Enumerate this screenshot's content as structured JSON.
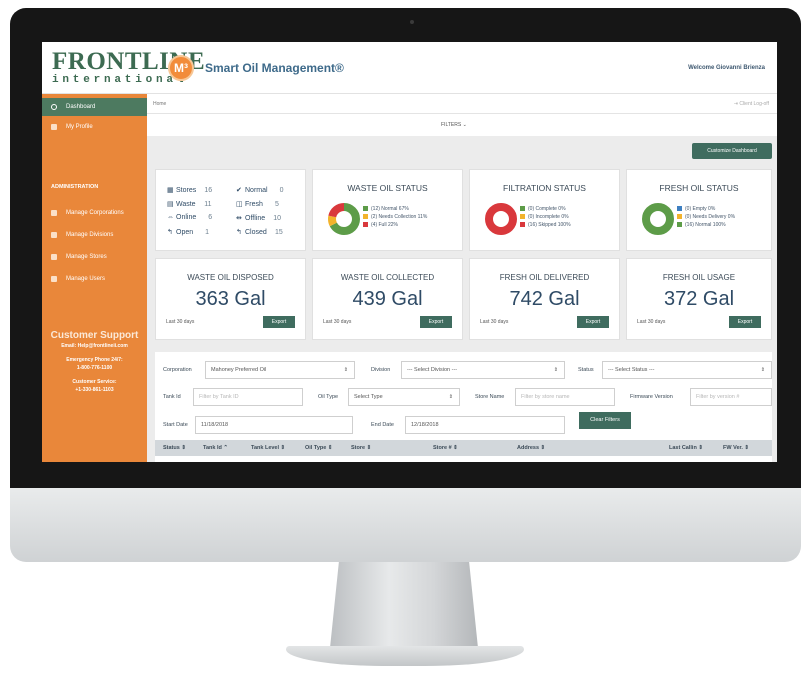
{
  "header": {
    "logo_main": "FRONTLINE",
    "logo_sub": "international",
    "app_badge": "M³",
    "app_title": "Smart Oil Management®",
    "welcome": "Welcome Giovanni Brienza"
  },
  "sidebar": {
    "items": [
      {
        "label": "Dashboard",
        "icon": "dashboard-icon"
      },
      {
        "label": "My Profile",
        "icon": "user-icon"
      }
    ],
    "admin_heading": "ADMINISTRATION",
    "admin_items": [
      {
        "label": "Manage Corporations",
        "icon": "building-icon"
      },
      {
        "label": "Manage Divisions",
        "icon": "folder-icon"
      },
      {
        "label": "Manage Stores",
        "icon": "chart-icon"
      },
      {
        "label": "Manage Users",
        "icon": "users-icon"
      }
    ],
    "support": {
      "title": "Customer Support",
      "email": "Email: Help@frontlineii.com",
      "emergency_label": "Emergency Phone 24/7:",
      "emergency_phone": "1-800-776-1100",
      "service_label": "Customer Service:",
      "service_phone": "+1-330-861-1103"
    }
  },
  "breadcrumb": {
    "home": "Home",
    "logoff": "⇥ Client Log-off"
  },
  "filters_toggle": "FILTERS ⌄",
  "customize_label": "Customize Dashboard",
  "stats": {
    "stores": {
      "label": "Stores",
      "value": "16"
    },
    "waste": {
      "label": "Waste",
      "value": "11"
    },
    "online": {
      "label": "Online",
      "value": "6"
    },
    "open": {
      "label": "Open",
      "value": "1"
    },
    "normal": {
      "label": "Normal",
      "value": "0"
    },
    "fresh": {
      "label": "Fresh",
      "value": "5"
    },
    "offline": {
      "label": "Offline",
      "value": "10"
    },
    "closed": {
      "label": "Closed",
      "value": "15"
    }
  },
  "waste_status": {
    "title": "WASTE OIL STATUS",
    "legend": [
      "(12) Normal 67%",
      "(2) Needs Collection 11%",
      "(4) Full 22%"
    ],
    "colors": [
      "#5d9c48",
      "#f2b32c",
      "#d9383c"
    ],
    "fractions": [
      0.67,
      0.11,
      0.22
    ]
  },
  "filtration_status": {
    "title": "FILTRATION STATUS",
    "legend": [
      "(0) Complete 0%",
      "(0) Incomplete 0%",
      "(16) Skipped 100%"
    ],
    "colors": [
      "#5d9c48",
      "#f2b32c",
      "#d9383c"
    ],
    "fractions": [
      0,
      0,
      1
    ]
  },
  "fresh_status": {
    "title": "FRESH OIL STATUS",
    "legend": [
      "(0) Empty 0%",
      "(0) Needs Delivery 0%",
      "(16) Normal 100%"
    ],
    "colors": [
      "#3d7fc1",
      "#f2b32c",
      "#5d9c48"
    ],
    "fractions": [
      0,
      0,
      1
    ]
  },
  "metrics": [
    {
      "title": "WASTE OIL DISPOSED",
      "value": "363 Gal",
      "period": "Last 30 days",
      "button": "Export"
    },
    {
      "title": "WASTE OIL COLLECTED",
      "value": "439 Gal",
      "period": "Last 30 days",
      "button": "Export"
    },
    {
      "title": "FRESH OIL DELIVERED",
      "value": "742 Gal",
      "period": "Last 30 days",
      "button": "Export"
    },
    {
      "title": "FRESH OIL USAGE",
      "value": "372 Gal",
      "period": "Last 30 days",
      "button": "Export"
    }
  ],
  "filters": {
    "corporation_label": "Corporation",
    "corporation_value": "Mahoney Preferred Oil",
    "division_label": "Division",
    "division_value": "--- Select Division ---",
    "status_label": "Status",
    "status_value": "--- Select Status ---",
    "tank_label": "Tank Id",
    "tank_placeholder": "Filter by Tank ID",
    "oiltype_label": "Oil Type",
    "oiltype_value": "Select Type",
    "storename_label": "Store Name",
    "storename_placeholder": "Filter by store name",
    "firmware_label": "Firmware Version",
    "firmware_placeholder": "Filter by version #",
    "start_label": "Start Date",
    "start_value": "11/18/2018",
    "end_label": "End Date",
    "end_value": "12/18/2018",
    "clear_label": "Clear Filters"
  },
  "table": {
    "columns": [
      "Status ⇕",
      "Tank Id ⌃",
      "Tank Level ⇕",
      "Oil Type ⇕",
      "Store ⇕",
      "Store # ⇕",
      "Address ⇕",
      "Last Callin ⇕",
      "FW Ver. ⇕"
    ]
  }
}
